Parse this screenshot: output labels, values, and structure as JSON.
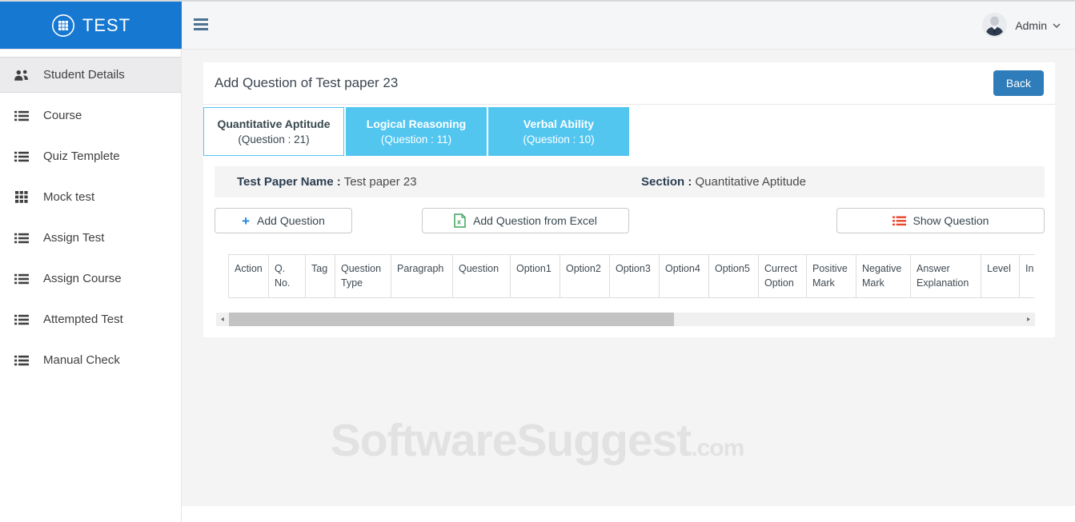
{
  "colors": {
    "brand_blue": "#1778d2",
    "back_button_blue": "#2f7cba",
    "tab_blue": "#53c6f0",
    "show_icon_orange": "#e8472b",
    "excel_icon_green": "#3fa45b",
    "plus_icon_blue": "#1e88e5"
  },
  "topbar": {
    "logo_text": "TEST",
    "user": {
      "name": "Admin"
    }
  },
  "sidebar": {
    "items": [
      {
        "label": "Student Details",
        "icon": "users-icon",
        "active": true
      },
      {
        "label": "Course",
        "icon": "list-icon",
        "active": false
      },
      {
        "label": "Quiz Templete",
        "icon": "list-icon",
        "active": false
      },
      {
        "label": "Mock test",
        "icon": "grid-icon",
        "active": false
      },
      {
        "label": "Assign Test",
        "icon": "list-icon",
        "active": false
      },
      {
        "label": "Assign Course",
        "icon": "list-icon",
        "active": false
      },
      {
        "label": "Attempted Test",
        "icon": "list-icon",
        "active": false
      },
      {
        "label": "Manual Check",
        "icon": "list-icon",
        "active": false
      }
    ]
  },
  "main": {
    "title": "Add Question of Test paper 23",
    "back_label": "Back",
    "tabs": [
      {
        "title": "Quantitative Aptitude",
        "subtitle": "(Question : 21)",
        "active": true
      },
      {
        "title": "Logical Reasoning",
        "subtitle": "(Question : 11)",
        "active": false
      },
      {
        "title": "Verbal Ability",
        "subtitle": "(Question : 10)",
        "active": false
      }
    ],
    "info": {
      "paper_label": "Test Paper Name :",
      "paper_value": "Test paper 23",
      "section_label": "Section :",
      "section_value": "Quantitative Aptitude"
    },
    "actions": {
      "add_question": "Add Question",
      "add_from_excel": "Add Question from Excel",
      "show_question": "Show Question",
      "plus_glyph": "+"
    },
    "table": {
      "columns": [
        "Action",
        "Q. No.",
        "Tag",
        "Question Type",
        "Paragraph",
        "Question",
        "Option1",
        "Option2",
        "Option3",
        "Option4",
        "Option5",
        "Currect Option",
        "Positive Mark",
        "Negative Mark",
        "Answer Explanation",
        "Level",
        "In"
      ],
      "rows": []
    },
    "scrollbar": {
      "left_arrow": "◄",
      "right_arrow": "►"
    }
  },
  "watermark": {
    "text": "SoftwareSuggest",
    "suffix": ".com"
  }
}
